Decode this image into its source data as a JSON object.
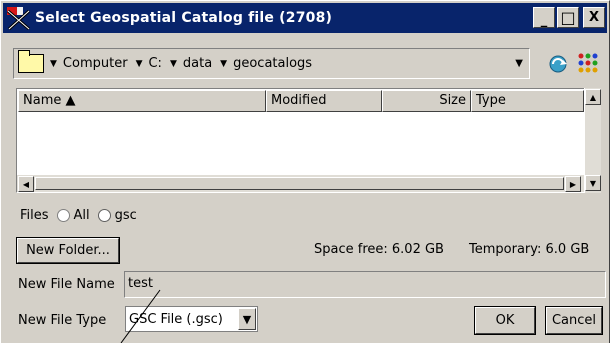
{
  "window": {
    "title": "Select Geospatial Catalog file (2708)",
    "minimize_glyph": "_",
    "maximize_glyph": "□",
    "close_glyph": "X"
  },
  "path": {
    "segments": [
      "Computer",
      "C:",
      "data",
      "geocatalogs"
    ]
  },
  "list": {
    "columns": [
      "Name ▲",
      "Modified",
      "Size",
      "Type"
    ],
    "rows": []
  },
  "filter": {
    "label": "Files",
    "options": [
      "All",
      "gsc"
    ],
    "selected": "gsc"
  },
  "buttons": {
    "new_folder": "New Folder...",
    "ok": "OK",
    "cancel": "Cancel"
  },
  "status": {
    "space_free": "Space free: 6.02 GB",
    "temporary": "Temporary: 6.0 GB"
  },
  "fields": {
    "new_file_name_label": "New File Name",
    "new_file_name_value": "test",
    "new_file_type_label": "New File Type",
    "new_file_type_value": "GSC File (.gsc)"
  },
  "colors": {
    "titlebar": "#08246b",
    "face": "#d4d0c8",
    "folder": "#fff9a8"
  }
}
